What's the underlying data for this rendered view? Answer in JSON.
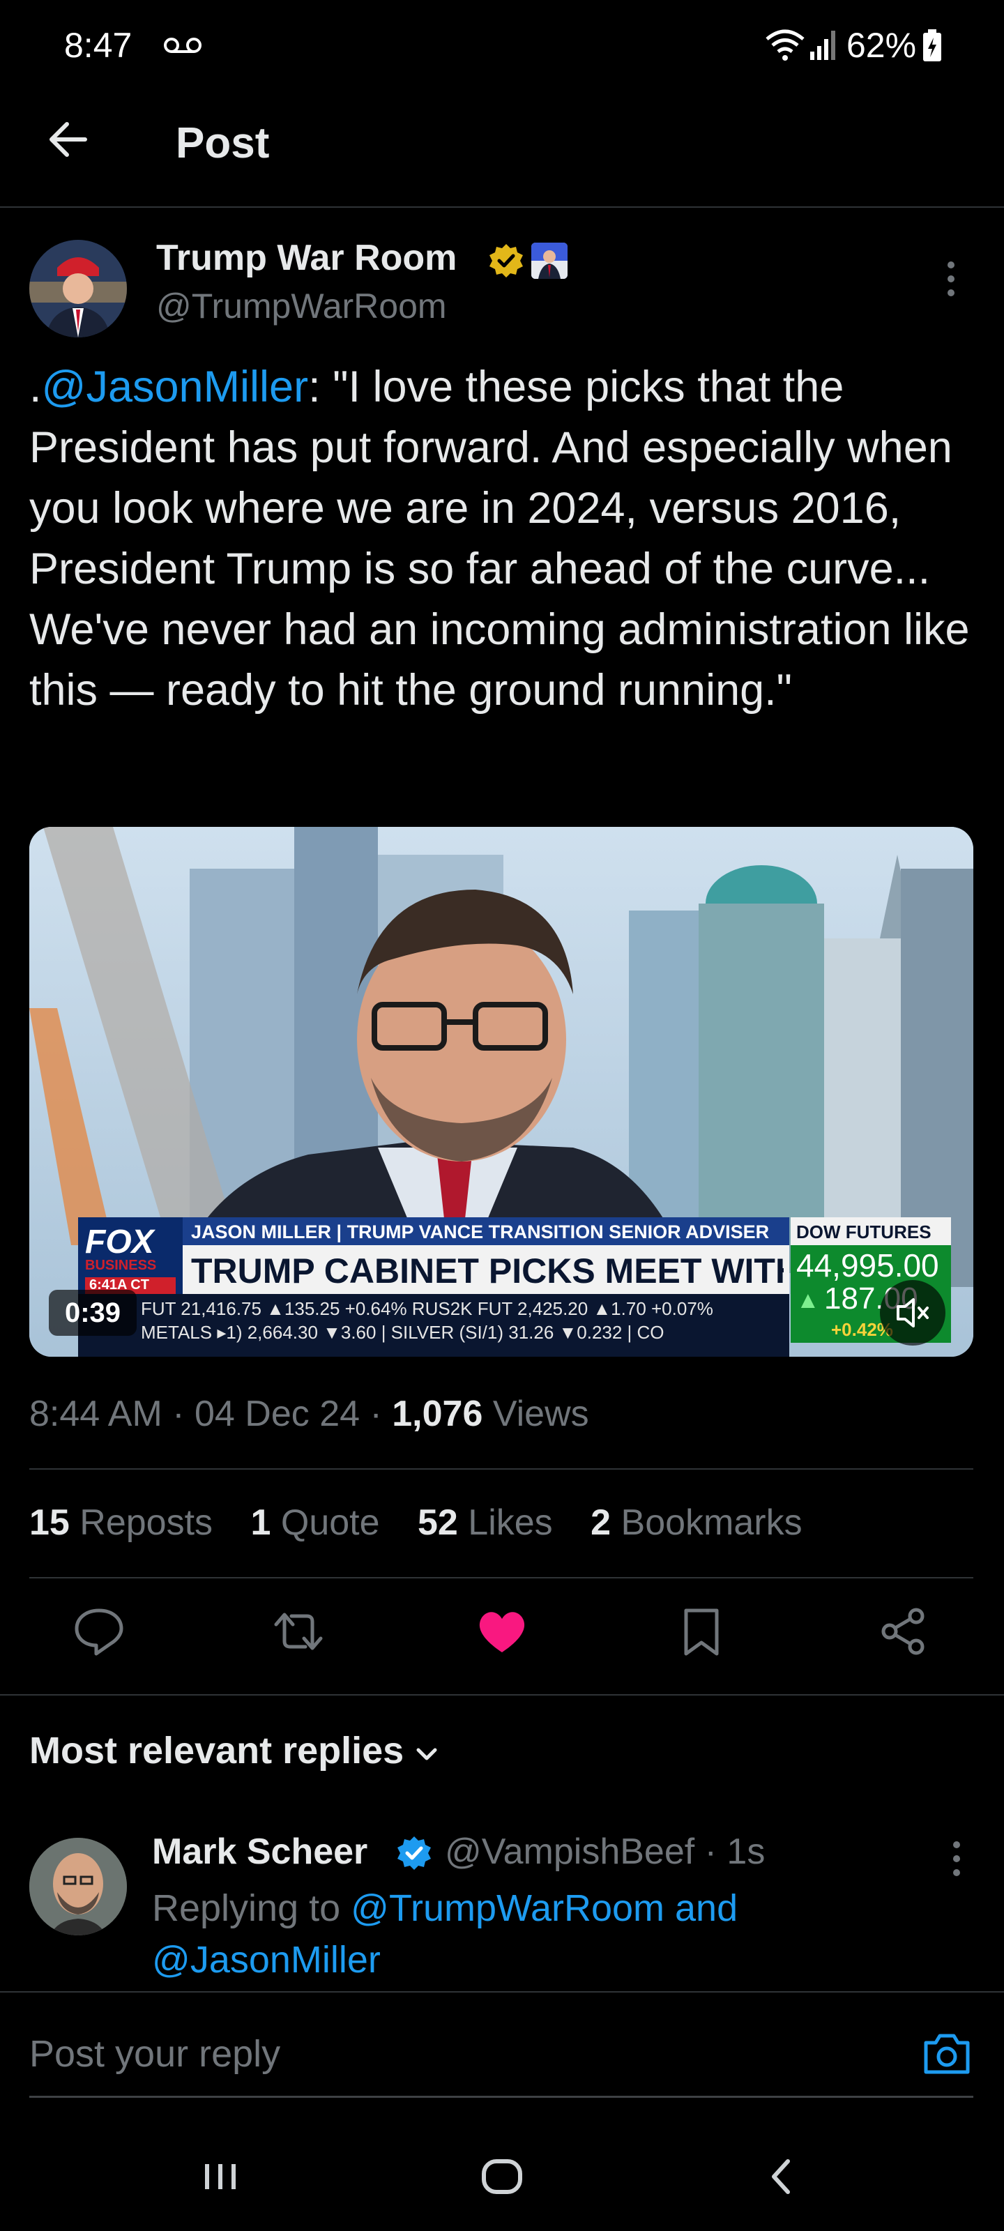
{
  "status_bar": {
    "time": "8:47",
    "battery_percent": "62%",
    "icons": [
      "voicemail-icon",
      "wifi-icon",
      "signal-icon",
      "battery-icon"
    ]
  },
  "header": {
    "title": "Post"
  },
  "post": {
    "author_name": "Trump War Room",
    "author_handle": "@TrumpWarRoom",
    "text_prefix": ".",
    "mention": "@JasonMiller",
    "text_body": ": \"I love these picks that the President has put forward. And especially when you look where we are in 2024, versus 2016, President Trump is so far ahead of the curve... We've never had an incoming administration like this — ready to hit the ground running.\"",
    "video": {
      "duration": "0:39",
      "lower_third": {
        "network": "FOX",
        "network_sub": "BUSINESS",
        "time_tag": "6:41A CT",
        "name_line": "JASON MILLER | TRUMP VANCE TRANSITION SENIOR ADVISER",
        "headline": "TRUMP CABINET PICKS MEET WITH SENATORS",
        "dow_label": "DOW FUTURES",
        "dow_value": "44,995.00",
        "dow_change": "187.00",
        "dow_pct": "+0.42%",
        "ticker_1": "FUT  21,416.75 ▲135.25 +0.64%  RUS2K FUT  2,425.20 ▲1.70 +0.07%",
        "ticker_2": "METALS  ▸1) 2,664.30 ▼3.60 | SILVER (SI/1) 31.26 ▼0.232 | CO"
      }
    },
    "meta_time": "8:44 AM · 04 Dec 24 · ",
    "views_count": "1,076",
    "views_label": " Views"
  },
  "stats": {
    "reposts_count": "15",
    "reposts_label": " Reposts",
    "quotes_count": "1",
    "quotes_label": " Quote",
    "likes_count": "52",
    "likes_label": " Likes",
    "bookmarks_count": "2",
    "bookmarks_label": " Bookmarks"
  },
  "actions": [
    "reply-icon",
    "repost-icon",
    "like-icon",
    "bookmark-icon",
    "share-icon"
  ],
  "colors": {
    "accent": "#1d9bf0",
    "like": "#f91880",
    "verified_gold": "#e2b719",
    "muted": "#71767b"
  },
  "replies": {
    "heading": "Most relevant replies",
    "items": [
      {
        "name": "Mark Scheer",
        "handle_time": "@VampishBeef · 1s",
        "replying_prefix": "Replying to ",
        "replying_targets": "@TrumpWarRoom and @JasonMiller"
      }
    ]
  },
  "composer": {
    "placeholder": "Post your reply"
  }
}
